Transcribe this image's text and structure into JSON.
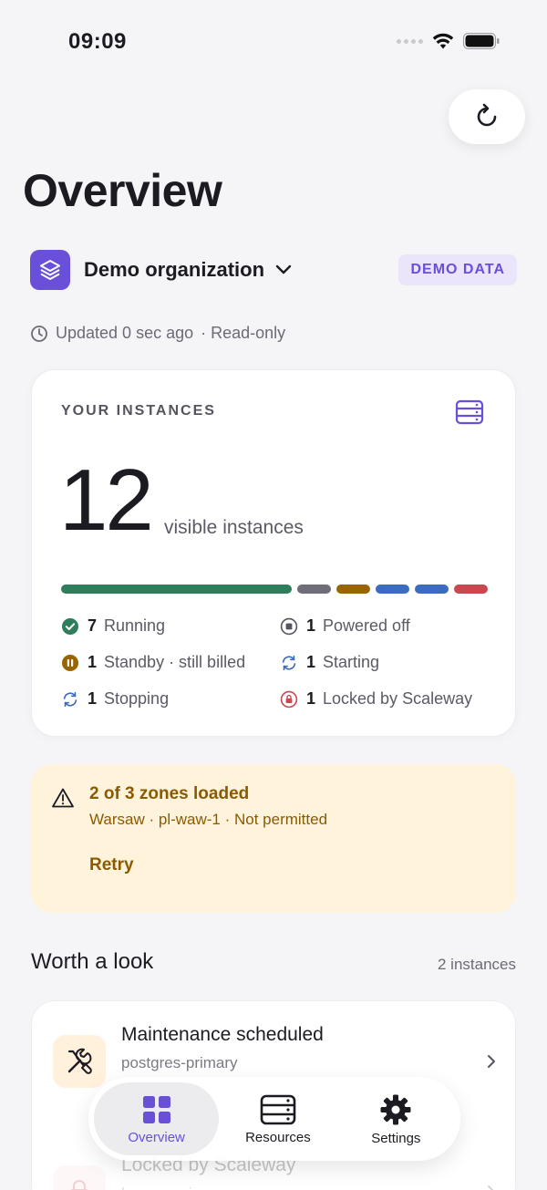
{
  "status_bar": {
    "time": "09:09"
  },
  "page": {
    "title": "Overview"
  },
  "org": {
    "name": "Demo organization",
    "badge": "DEMO DATA"
  },
  "updated": {
    "text": "Updated 0 sec ago",
    "mode": "· Read-only"
  },
  "instances_card": {
    "label": "YOUR INSTANCES",
    "count": "12",
    "count_label": "visible instances",
    "segments": [
      {
        "status": "running",
        "value": 7,
        "color": "#2e7d5b"
      },
      {
        "status": "powered_off",
        "value": 1,
        "color": "#6f6e78"
      },
      {
        "status": "standby",
        "value": 1,
        "color": "#9a6400"
      },
      {
        "status": "starting",
        "value": 1,
        "color": "#3c6cc0"
      },
      {
        "status": "stopping",
        "value": 1,
        "color": "#3c6cc0"
      },
      {
        "status": "locked",
        "value": 1,
        "color": "#c9474f"
      }
    ],
    "legend": {
      "running": {
        "count": "7",
        "label": "Running"
      },
      "powered_off": {
        "count": "1",
        "label": "Powered off"
      },
      "standby": {
        "count": "1",
        "label": "Standby · still billed"
      },
      "starting": {
        "count": "1",
        "label": "Starting"
      },
      "stopping": {
        "count": "1",
        "label": "Stopping"
      },
      "locked": {
        "count": "1",
        "label": "Locked by Scaleway"
      }
    }
  },
  "warning": {
    "title": "2 of 3 zones loaded",
    "subtitle": "Warsaw · pl-waw-1 · Not permitted",
    "action": "Retry"
  },
  "worth_a_look": {
    "title": "Worth a look",
    "count": "2 instances",
    "items": [
      {
        "title": "Maintenance scheduled",
        "subtitle": "postgres-primary"
      },
      {
        "title": "Locked by Scaleway",
        "subtitle": "legacy-api"
      }
    ]
  },
  "tabs": {
    "overview": "Overview",
    "resources": "Resources",
    "settings": "Settings"
  },
  "colors": {
    "accent": "#6a4fd8",
    "warning_bg": "#fff3dc",
    "warning_text": "#8a5a00"
  }
}
